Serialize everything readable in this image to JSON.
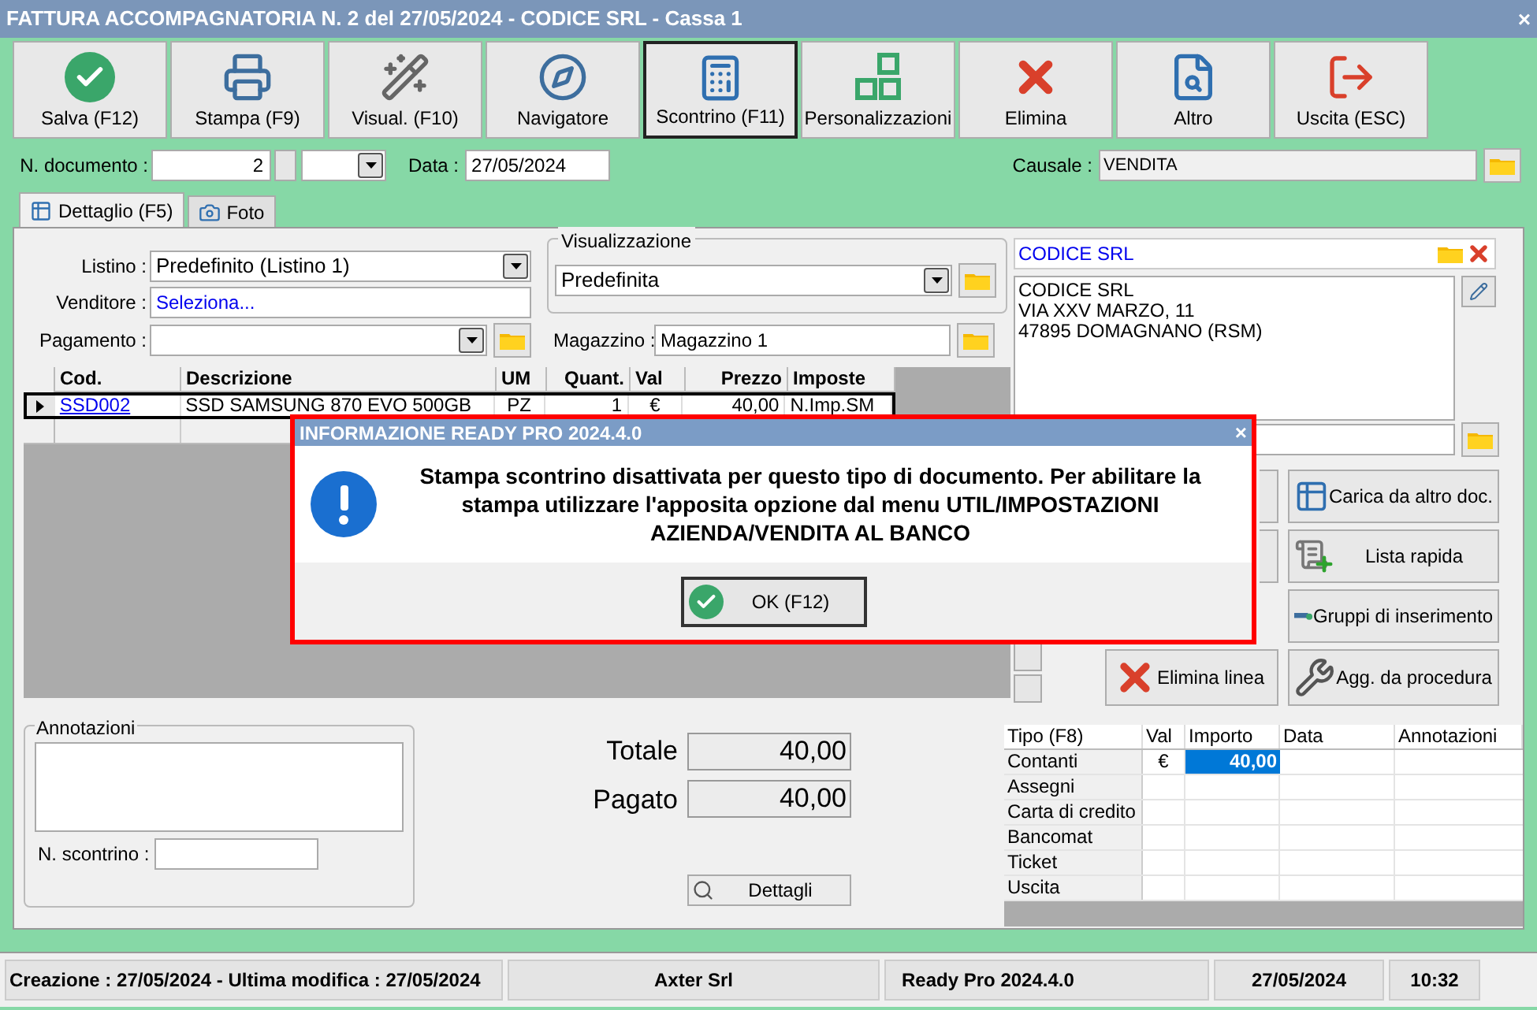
{
  "window": {
    "title": "FATTURA ACCOMPAGNATORIA N. 2 del 27/05/2024 - CODICE SRL - Cassa 1",
    "close": "×"
  },
  "toolbar": [
    {
      "label": "Salva (F12)",
      "kind": "check",
      "selected": false
    },
    {
      "label": "Stampa (F9)",
      "kind": "printer",
      "selected": false
    },
    {
      "label": "Visual. (F10)",
      "kind": "wand",
      "selected": false
    },
    {
      "label": "Navigatore",
      "kind": "compass",
      "selected": false
    },
    {
      "label": "Scontrino (F11)",
      "kind": "register",
      "selected": true
    },
    {
      "label": "Personalizzazioni",
      "kind": "squares",
      "selected": false
    },
    {
      "label": "Elimina",
      "kind": "cross",
      "selected": false
    },
    {
      "label": "Altro",
      "kind": "search",
      "selected": false
    },
    {
      "label": "Uscita (ESC)",
      "kind": "exit",
      "selected": false
    }
  ],
  "document": {
    "number_label": "N. documento :",
    "number": "2",
    "date_label": "Data :",
    "date": "27/05/2024",
    "causale_label": "Causale :",
    "causale": "VENDITA"
  },
  "tabs": [
    {
      "label": "Dettaglio (F5)",
      "kind": "table",
      "selected": true
    },
    {
      "label": "Foto",
      "kind": "camera",
      "selected": false
    }
  ],
  "form": {
    "listino_label": "Listino :",
    "listino": "Predefinito (Listino 1)",
    "venditore_label": "Venditore :",
    "venditore": "Seleziona...",
    "pagamento_label": "Pagamento :",
    "visualizzazione_title": "Visualizzazione",
    "visualizzazione": "Predefinita",
    "magazzino_label": "Magazzino :",
    "magazzino": "Magazzino 1"
  },
  "lines_table": {
    "columns": [
      "Cod.",
      "Descrizione",
      "UM",
      "Quant.",
      "Val",
      "Prezzo",
      "Imposte"
    ],
    "rows": [
      {
        "selected": true,
        "cells": [
          "SSD002",
          "SSD SAMSUNG 870 EVO 500GB",
          "PZ",
          "1",
          "€",
          "40,00",
          "N.Imp.SM"
        ]
      }
    ]
  },
  "customer": {
    "name": "CODICE SRL",
    "address": [
      "CODICE SRL",
      "VIA XXV MARZO, 11",
      "47895 DOMAGNANO (RSM)"
    ]
  },
  "side_buttons": [
    {
      "label": "Carica da altro doc.",
      "kind": "grid"
    },
    {
      "label": "Lista rapida",
      "kind": "scroll"
    },
    {
      "label": "Gruppi di inserimento",
      "kind": "bar"
    },
    {
      "label": "Elimina linea",
      "kind": "cross"
    },
    {
      "label": "Agg. da procedura",
      "kind": "wrench"
    }
  ],
  "notes": {
    "title": "Annotazioni",
    "receipt_label": "N. scontrino :"
  },
  "totals": [
    {
      "label": "Totale",
      "value": "40,00"
    },
    {
      "label": "Pagato",
      "value": "40,00"
    }
  ],
  "details_button": "Dettagli",
  "payments": {
    "columns": [
      "Tipo (F8)",
      "Val",
      "Importo",
      "Data",
      "Annotazioni"
    ],
    "rows": [
      {
        "type": "Contanti",
        "currency": "€",
        "amount": "40,00",
        "selected": true
      },
      {
        "type": "Assegni",
        "selected": false
      },
      {
        "type": "Carta di credito",
        "selected": false
      },
      {
        "type": "Bancomat",
        "selected": false
      },
      {
        "type": "Ticket",
        "selected": false
      },
      {
        "type": "Uscita",
        "selected": false
      }
    ]
  },
  "status_bar": [
    "Creazione : 27/05/2024 - Ultima modifica : 27/05/2024",
    "Axter Srl",
    "Ready Pro 2024.4.0",
    "27/05/2024",
    "10:32"
  ],
  "dialog": {
    "title": "INFORMAZIONE READY PRO 2024.4.0",
    "close": "×",
    "message": "Stampa scontrino disattivata per questo tipo di documento. Per abilitare la stampa utilizzare l'apposita opzione dal menu UTIL/IMPOSTAZIONI AZIENDA/VENDITA AL BANCO",
    "button": "OK (F12)"
  }
}
